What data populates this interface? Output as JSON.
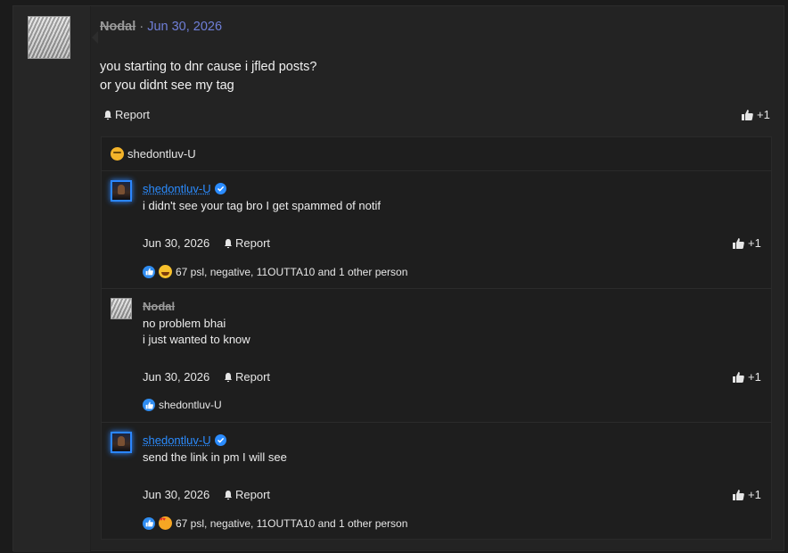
{
  "post": {
    "author": "Nodal",
    "separator": "·",
    "date": "Jun 30, 2026",
    "lines": [
      "you starting to dnr cause i jfled posts?",
      "or you didnt see my tag"
    ],
    "report_label": "Report",
    "like_count": "+1"
  },
  "replies_header": {
    "name": "shedontluv-U"
  },
  "replies": [
    {
      "name": "shedontluv-U",
      "lines": [
        "i didn't see your tag bro I get spammed of notif"
      ],
      "date": "Jun 30, 2026",
      "report_label": "Report",
      "like_count": "+1",
      "reactions_text": "67 psl, negative, 11OUTTA10 and 1 other person"
    },
    {
      "name": "Nodal",
      "lines": [
        "no problem bhai",
        "i just wanted to know"
      ],
      "date": "Jun 30, 2026",
      "report_label": "Report",
      "like_count": "+1",
      "reactions_text": "shedontluv-U"
    },
    {
      "name": "shedontluv-U",
      "lines": [
        "send the link in pm I will see"
      ],
      "date": "Jun 30, 2026",
      "report_label": "Report",
      "like_count": "+1",
      "reactions_text": "67 psl, negative, 11OUTTA10 and 1 other person"
    }
  ],
  "icons": {
    "report": "bell-icon",
    "like": "thumbs-up-icon",
    "verified": "verified-badge-icon"
  },
  "colors": {
    "background": "#1b1b1b",
    "accent_link": "#6f7fd8",
    "username_blue": "#2b8cff",
    "like_badge": "#2f8cf0"
  }
}
